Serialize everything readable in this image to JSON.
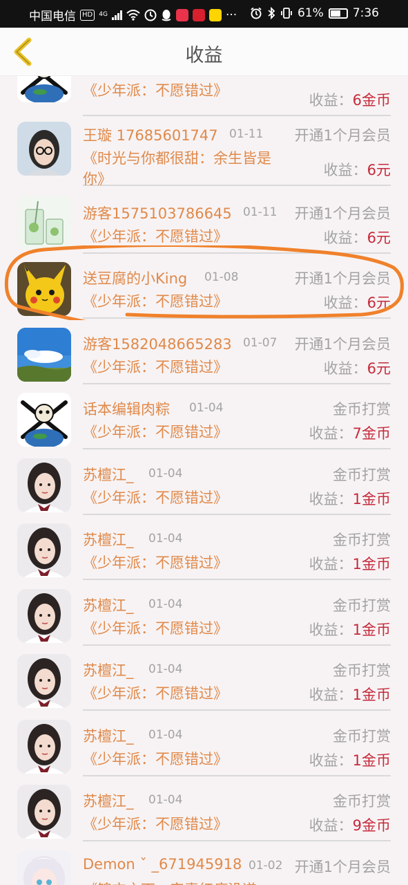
{
  "status_bar": {
    "carrier": "中国电信",
    "hd_badge": "HD",
    "network": "4G",
    "battery": "61%",
    "time": "7:36",
    "more": "···",
    "icons": [
      "hd-icon",
      "signal-icon",
      "wifi-icon",
      "clock-icon",
      "qq-icon",
      "app-icon",
      "app-icon",
      "chat-icon",
      "alarm-icon",
      "bluetooth-icon",
      "vibrate-icon",
      "battery-icon"
    ]
  },
  "header": {
    "title": "收益",
    "back_icon": "chevron-left-icon"
  },
  "records": [
    {
      "name": "",
      "date": "",
      "type": "",
      "book": "《少年派：不愿错过》",
      "earn_label": "收益：",
      "earn_value": "6金币",
      "avatar": "earth-skull"
    },
    {
      "name": "王璇 17685601747",
      "date": "01-11",
      "type": "开通1个月会员",
      "book": "《时光与你都很甜：余生皆是你》",
      "earn_label": "收益：",
      "earn_value": "6元",
      "avatar": "girl-glasses"
    },
    {
      "name": "游客1575103786645",
      "date": "01-11",
      "type": "开通1个月会员",
      "book": "《少年派：不愿错过》",
      "earn_label": "收益：",
      "earn_value": "6元",
      "avatar": "drink"
    },
    {
      "name": "送豆腐的小King",
      "date": "01-08",
      "type": "开通1个月会员",
      "book": "《少年派：不愿错过》",
      "earn_label": "收益：",
      "earn_value": "6元",
      "avatar": "pikachu"
    },
    {
      "name": "游客1582048665283",
      "date": "01-07",
      "type": "开通1个月会员",
      "book": "《少年派：不愿错过》",
      "earn_label": "收益：",
      "earn_value": "6元",
      "avatar": "sky"
    },
    {
      "name": "话本编辑肉粽",
      "date": "01-04",
      "type": "金币打赏",
      "book": "《少年派：不愿错过》",
      "earn_label": "收益：",
      "earn_value": "7金币",
      "avatar": "earth-skull"
    },
    {
      "name": "苏檀江_",
      "date": "01-04",
      "type": "金币打赏",
      "book": "《少年派：不愿错过》",
      "earn_label": "收益：",
      "earn_value": "1金币",
      "avatar": "girl-portrait"
    },
    {
      "name": "苏檀江_",
      "date": "01-04",
      "type": "金币打赏",
      "book": "《少年派：不愿错过》",
      "earn_label": "收益：",
      "earn_value": "1金币",
      "avatar": "girl-portrait"
    },
    {
      "name": "苏檀江_",
      "date": "01-04",
      "type": "金币打赏",
      "book": "《少年派：不愿错过》",
      "earn_label": "收益：",
      "earn_value": "1金币",
      "avatar": "girl-portrait"
    },
    {
      "name": "苏檀江_",
      "date": "01-04",
      "type": "金币打赏",
      "book": "《少年派：不愿错过》",
      "earn_label": "收益：",
      "earn_value": "1金币",
      "avatar": "girl-portrait"
    },
    {
      "name": "苏檀江_",
      "date": "01-04",
      "type": "金币打赏",
      "book": "《少年派：不愿错过》",
      "earn_label": "收益：",
      "earn_value": "1金币",
      "avatar": "girl-portrait"
    },
    {
      "name": "苏檀江_",
      "date": "01-04",
      "type": "金币打赏",
      "book": "《少年派：不愿错过》",
      "earn_label": "收益：",
      "earn_value": "9金币",
      "avatar": "girl-portrait"
    },
    {
      "name": "Demon ˇ _671945918",
      "date": "01-02",
      "type": "开通1个月会员",
      "book": "《锦衣之下：安素红瘦没道",
      "earn_label": "",
      "earn_value": "",
      "avatar": "anime-girl"
    }
  ],
  "colors": {
    "accent_orange": "#e0894a",
    "earnings_red": "#c62a3c",
    "secondary_gray": "#a3a3a3",
    "highlight_stroke": "#f0812b",
    "background": "#f7f3f4"
  }
}
